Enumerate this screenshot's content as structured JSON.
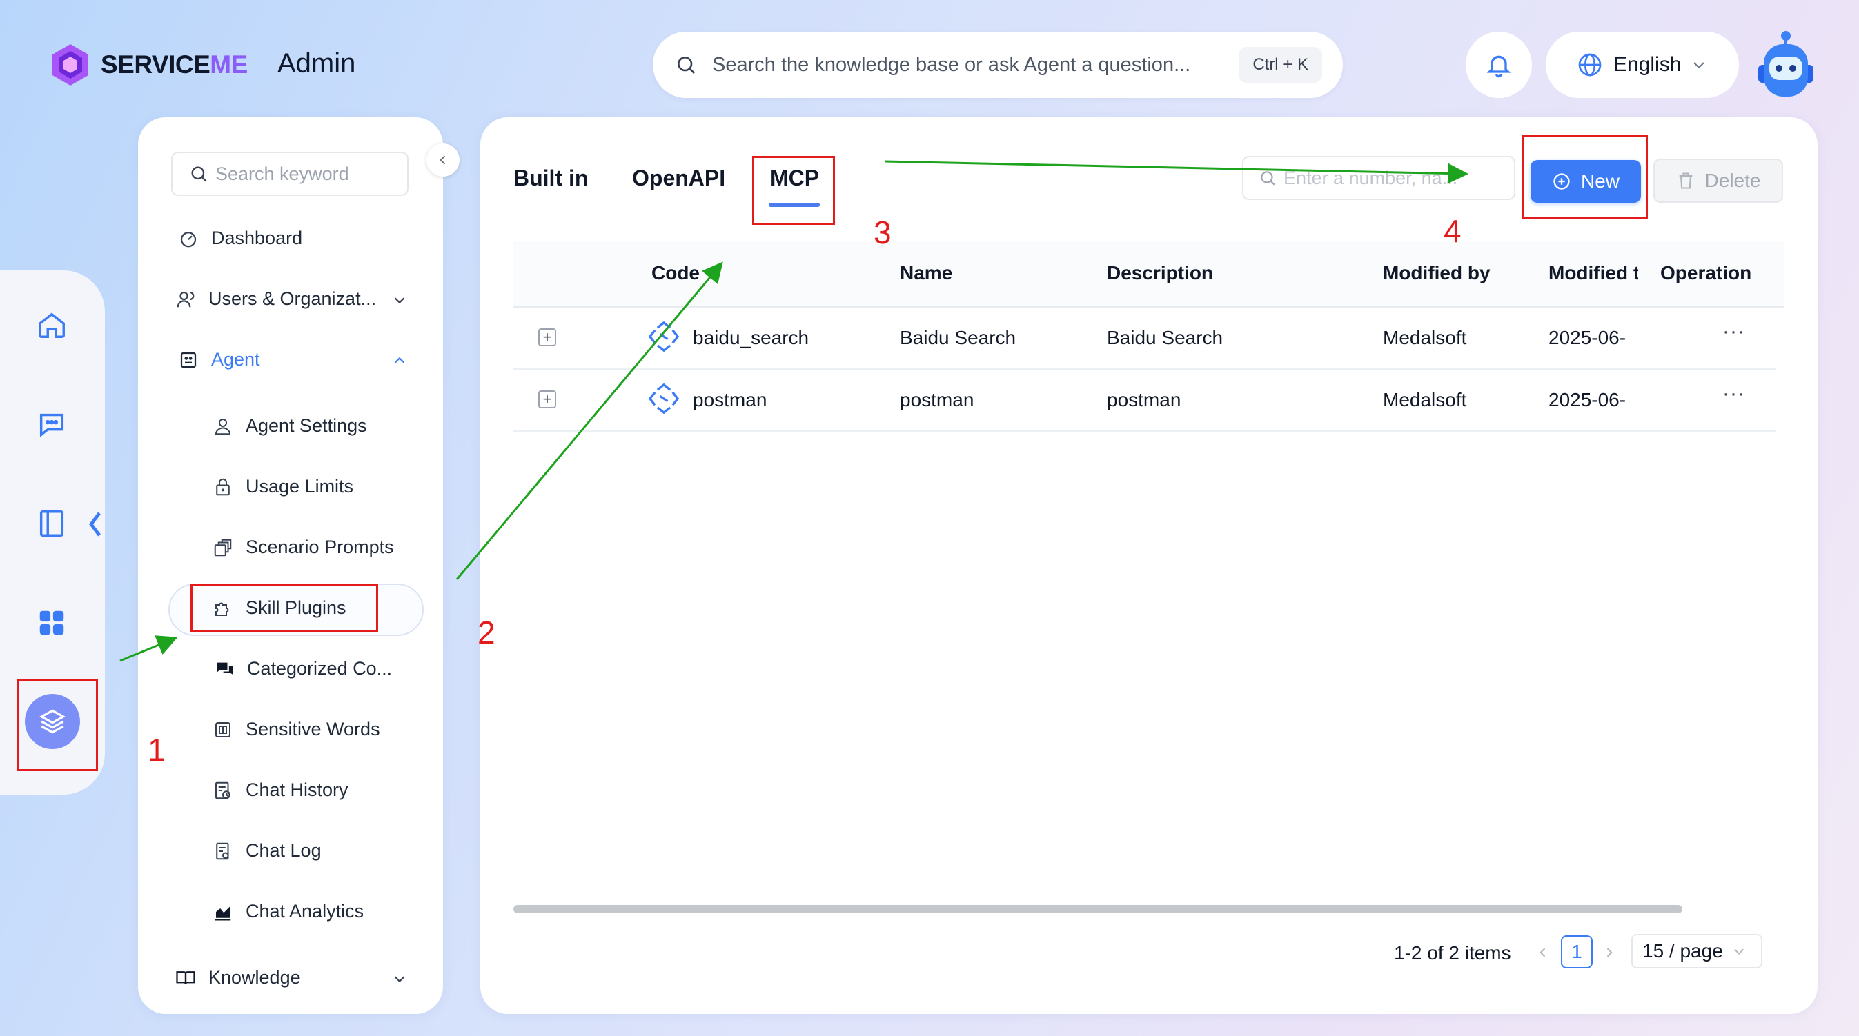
{
  "header": {
    "logo_prefix": "SERVICE",
    "logo_suffix": "ME",
    "app_title": "Admin",
    "search_placeholder": "Search the knowledge base or ask Agent a question...",
    "search_shortcut": "Ctrl + K",
    "language": "English"
  },
  "rail": {
    "items": [
      "home-icon",
      "chat-icon",
      "book-icon",
      "apps-icon",
      "layers-icon"
    ],
    "active": "layers-icon"
  },
  "sidebar": {
    "search_placeholder": "Search keyword",
    "items": [
      {
        "label": "Dashboard",
        "icon": "dashboard-icon"
      },
      {
        "label": "Users & Organizat...",
        "icon": "users-icon"
      },
      {
        "label": "Agent",
        "icon": "agent-icon"
      },
      {
        "label": "Agent Settings",
        "icon": "agent-settings-icon"
      },
      {
        "label": "Usage Limits",
        "icon": "lock-icon"
      },
      {
        "label": "Scenario Prompts",
        "icon": "prompts-icon"
      },
      {
        "label": "Skill Plugins",
        "icon": "plugin-icon"
      },
      {
        "label": "Categorized Co...",
        "icon": "categorized-icon"
      },
      {
        "label": "Sensitive Words",
        "icon": "sensitive-icon"
      },
      {
        "label": "Chat History",
        "icon": "history-icon"
      },
      {
        "label": "Chat Log",
        "icon": "log-icon"
      },
      {
        "label": "Chat Analytics",
        "icon": "analytics-icon"
      },
      {
        "label": "Knowledge",
        "icon": "knowledge-icon"
      }
    ]
  },
  "main": {
    "tabs": [
      "Built in",
      "OpenAPI",
      "MCP"
    ],
    "active_tab": "MCP",
    "filter_placeholder": "Enter a number, na...",
    "new_label": "New",
    "delete_label": "Delete",
    "columns": [
      "Code",
      "Name",
      "Description",
      "Modified by",
      "Modified t",
      "Operation"
    ],
    "rows": [
      {
        "code": "baidu_search",
        "name": "Baidu Search",
        "description": "Baidu Search",
        "modified_by": "Medalsoft",
        "modified": "2025-06-",
        "op": "···"
      },
      {
        "code": "postman",
        "name": "postman",
        "description": "postman",
        "modified_by": "Medalsoft",
        "modified": "2025-06-",
        "op": "···"
      }
    ],
    "pagination": {
      "total_text": "1-2 of 2 items",
      "current_page": "1",
      "page_size": "15 / page"
    }
  },
  "annotations": {
    "step1": "1",
    "step2": "2",
    "step3": "3",
    "step4": "4"
  },
  "colors": {
    "accent": "#3b7cf6",
    "annotation_red": "#e41b1b",
    "annotation_green": "#1ea31e",
    "rail_active": "#7c8ff7"
  }
}
